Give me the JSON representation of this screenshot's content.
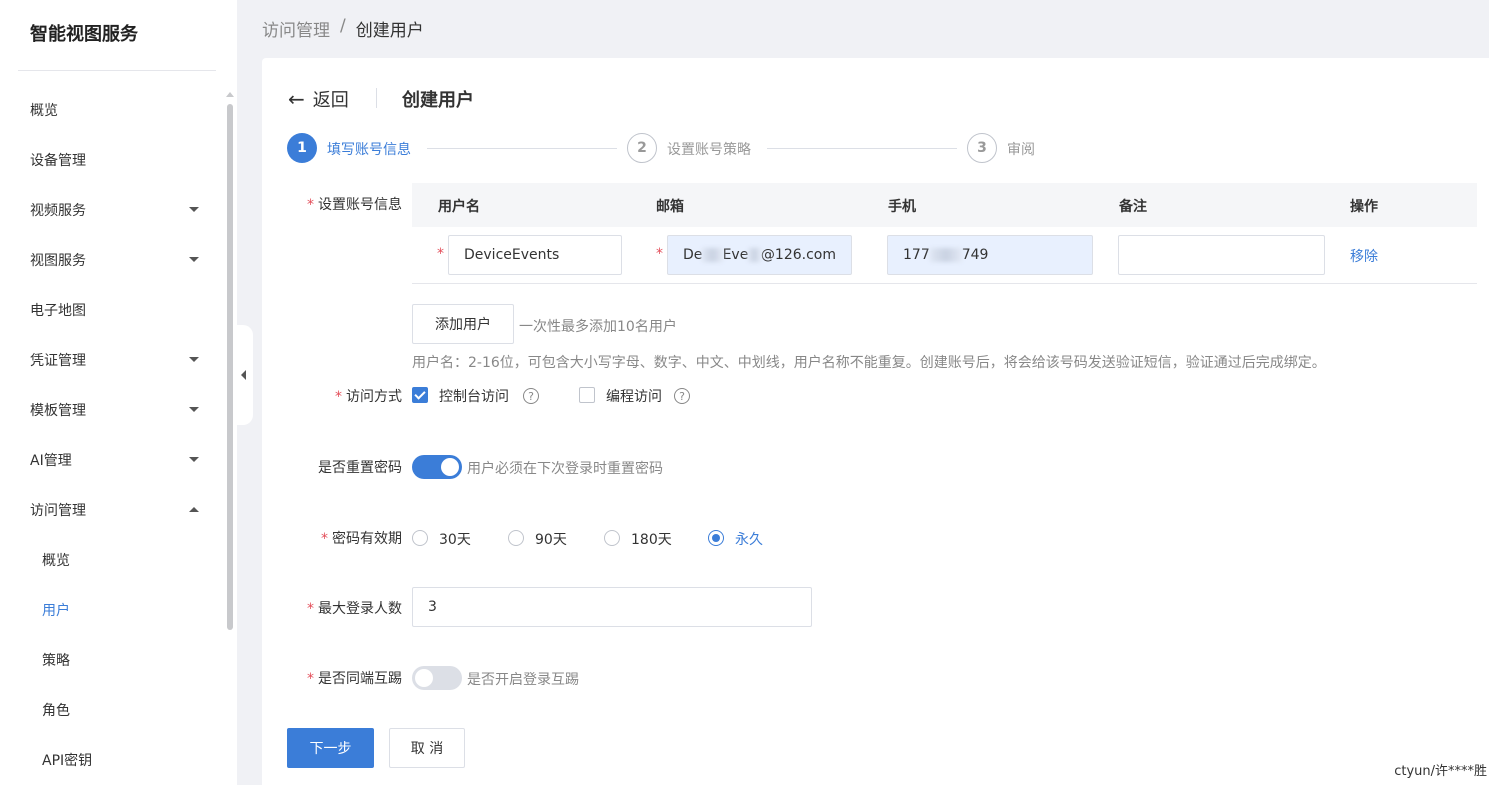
{
  "sidebar": {
    "title": "智能视图服务",
    "items": [
      {
        "label": "概览",
        "has_caret": false
      },
      {
        "label": "设备管理",
        "has_caret": false
      },
      {
        "label": "视频服务",
        "has_caret": true
      },
      {
        "label": "视图服务",
        "has_caret": true
      },
      {
        "label": "电子地图",
        "has_caret": false
      },
      {
        "label": "凭证管理",
        "has_caret": true
      },
      {
        "label": "模板管理",
        "has_caret": true
      },
      {
        "label": "AI管理",
        "has_caret": true
      },
      {
        "label": "访问管理",
        "has_caret": true,
        "expanded": true
      }
    ],
    "sub_items": [
      {
        "label": "概览"
      },
      {
        "label": "用户",
        "active": true
      },
      {
        "label": "策略"
      },
      {
        "label": "角色"
      },
      {
        "label": "API密钥"
      }
    ]
  },
  "breadcrumb": {
    "parent": "访问管理",
    "separator": "/",
    "current": "创建用户"
  },
  "header": {
    "back_label": "返回",
    "title": "创建用户"
  },
  "steps": [
    {
      "number": "1",
      "label": "填写账号信息",
      "state": "active"
    },
    {
      "number": "2",
      "label": "设置账号策略",
      "state": "inactive"
    },
    {
      "number": "3",
      "label": "审阅",
      "state": "inactive"
    }
  ],
  "form": {
    "account_label": "设置账号信息",
    "table": {
      "columns": [
        "用户名",
        "邮箱",
        "手机",
        "备注",
        "操作"
      ],
      "row": {
        "username": "DeviceEvents",
        "email_prefix": "De",
        "email_mid": "Eve",
        "email_suffix": "@126.com",
        "phone_prefix": "177",
        "phone_suffix": "749",
        "remark": "",
        "action": "移除"
      }
    },
    "add_user_button": "添加用户",
    "add_user_hint": "一次性最多添加10名用户",
    "rule_hint": "用户名：2-16位，可包含大小写字母、数字、中文、中划线，用户名称不能重复。创建账号后，将会给该号码发送验证短信，验证通过后完成绑定。",
    "access_label": "访问方式",
    "access_options": [
      {
        "label": "控制台访问",
        "checked": true
      },
      {
        "label": "编程访问",
        "checked": false
      }
    ],
    "reset_pwd_label": "是否重置密码",
    "reset_pwd_on": true,
    "reset_pwd_desc": "用户必须在下次登录时重置密码",
    "pwd_validity_label": "密码有效期",
    "pwd_validity_options": [
      {
        "label": "30天",
        "checked": false
      },
      {
        "label": "90天",
        "checked": false
      },
      {
        "label": "180天",
        "checked": false
      },
      {
        "label": "永久",
        "checked": true
      }
    ],
    "max_login_label": "最大登录人数",
    "max_login_value": "3",
    "same_kick_label": "是否同端互踢",
    "same_kick_on": false,
    "same_kick_desc": "是否开启登录互踢"
  },
  "footer": {
    "next_button": "下一步",
    "cancel_button": "取 消"
  },
  "watermark": "ctyun/许****胜",
  "colors": {
    "accent": "#3b7dd8",
    "required": "#e34d59",
    "background": "#f0f1f5"
  }
}
